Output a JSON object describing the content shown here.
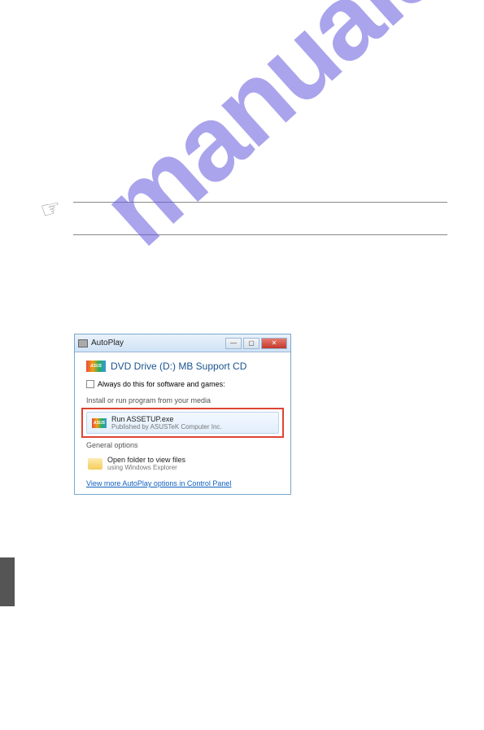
{
  "watermark": "manualshive.com",
  "autoplay": {
    "window_title": "AutoPlay",
    "dvd_title": "DVD Drive (D:) MB Support CD",
    "always_checkbox": "Always do this for software and games:",
    "install_label": "Install or run program from your media",
    "run_title": "Run ASSETUP.exe",
    "run_publisher": "Published by ASUSTeK Computer Inc.",
    "general_label": "General options",
    "folder_title": "Open folder to view files",
    "folder_sub": "using Windows Explorer",
    "link": "View more AutoPlay options in Control Panel",
    "logo_text": "ASUS"
  }
}
